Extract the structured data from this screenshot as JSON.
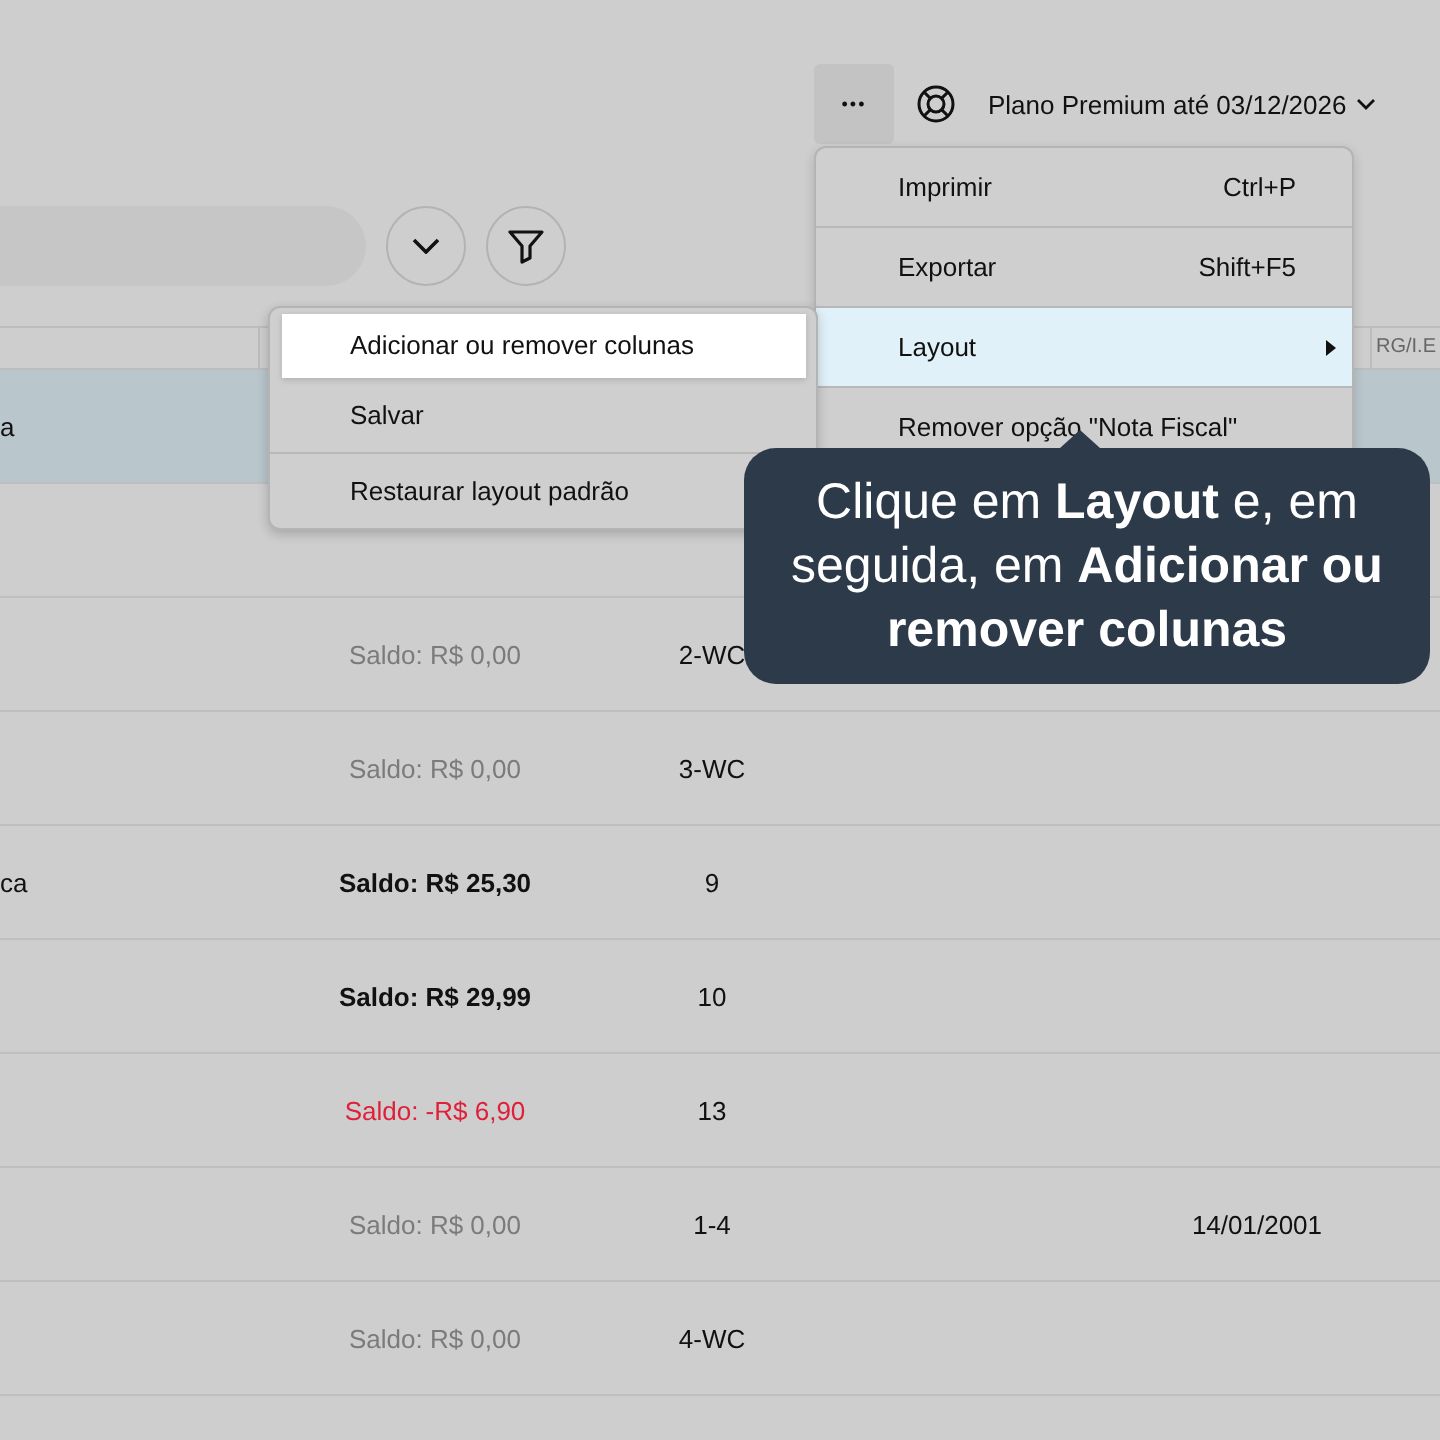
{
  "top_bar": {
    "more_button": "•••",
    "plan": "Plano Premium até 03/12/2026"
  },
  "table": {
    "header": {
      "column_last": "RG/I.E"
    },
    "rows": [
      {
        "selected": true,
        "name": "a"
      },
      {
        "selected": false
      },
      {
        "selected": false,
        "kind": "zero",
        "balance": "Saldo: R$ 0,00",
        "code": "2-WC"
      },
      {
        "selected": false,
        "kind": "zero",
        "balance": "Saldo: R$ 0,00",
        "code": "3-WC"
      },
      {
        "selected": false,
        "kind": "positive",
        "name": "ca",
        "balance": "Saldo: R$ 25,30",
        "code": "9"
      },
      {
        "selected": false,
        "kind": "positive",
        "balance": "Saldo: R$ 29,99",
        "code": "10"
      },
      {
        "selected": false,
        "kind": "negative",
        "balance": "Saldo: -R$ 6,90",
        "code": "13"
      },
      {
        "selected": false,
        "kind": "zero",
        "balance": "Saldo: R$ 0,00",
        "code": "1-4",
        "date": "14/01/2001"
      },
      {
        "selected": false,
        "kind": "zero",
        "balance": "Saldo: R$ 0,00",
        "code": "4-WC"
      }
    ]
  },
  "menu": {
    "items": [
      {
        "label": "Imprimir",
        "shortcut": "Ctrl+P",
        "selected": false,
        "has_submenu": false
      },
      {
        "label": "Exportar",
        "shortcut": "Shift+F5",
        "selected": false,
        "has_submenu": false
      },
      {
        "label": "Layout",
        "selected": true,
        "has_submenu": true
      },
      {
        "label": "Remover opção \"Nota Fiscal\"",
        "selected": false,
        "has_submenu": false
      }
    ]
  },
  "submenu": {
    "items": [
      {
        "label": "Adicionar ou remover colunas",
        "selected": true
      },
      {
        "label": "Salvar",
        "selected": false
      },
      {
        "label": "Restaurar layout padrão",
        "selected": false
      }
    ]
  },
  "tooltip": {
    "text": "Clique em **Layout** e, em seguida, em **Adicionar ou remover colunas**"
  }
}
